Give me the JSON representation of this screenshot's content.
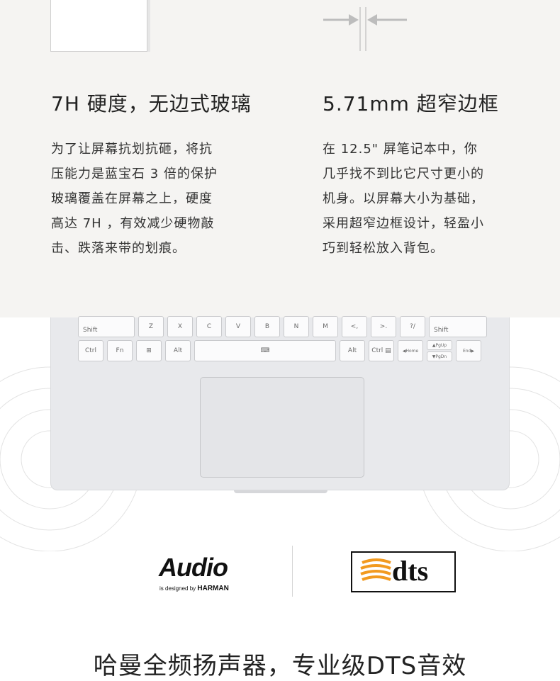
{
  "features": [
    {
      "title": "7H 硬度，无边式玻璃",
      "body": "为了让屏幕抗划抗砸，将抗\n压能力是蓝宝石 3 倍的保护\n玻璃覆盖在屏幕之上，硬度\n高达 7H ，有效减少硬物敲\n击、跌落来带的划痕。"
    },
    {
      "title": "5.71mm 超窄边框",
      "body": "在 12.5\" 屏笔记本中，你\n几乎找不到比它尺寸更小的\n机身。以屏幕大小为基础，\n采用超窄边框设计，轻盈小\n巧到轻松放入背包。"
    }
  ],
  "keyboard": {
    "row_shift": [
      "Shift",
      "Z",
      "X",
      "C",
      "V",
      "B",
      "N",
      "M",
      "<,",
      ">.",
      "?/",
      "Shift"
    ],
    "row_bottom": [
      "Ctrl",
      "Fn",
      "⊞",
      "Alt",
      "⌨",
      "",
      "Alt",
      "Ctrl ▤",
      "◀Home",
      "▲PgUp",
      "▼PgDn",
      "End▶"
    ]
  },
  "logos": {
    "audio_title": "Audio",
    "audio_sub_prefix": "is designed by",
    "audio_sub_brand": "HARMAN",
    "dts_text": "dts"
  },
  "caption": "哈曼全频扬声器，专业级DTS音效",
  "colors": {
    "panel_bg": "#f5f4f2",
    "text": "#2a2a2a",
    "dts_orange": "#f29a1f",
    "laptop_body": "#e8e9ec"
  }
}
